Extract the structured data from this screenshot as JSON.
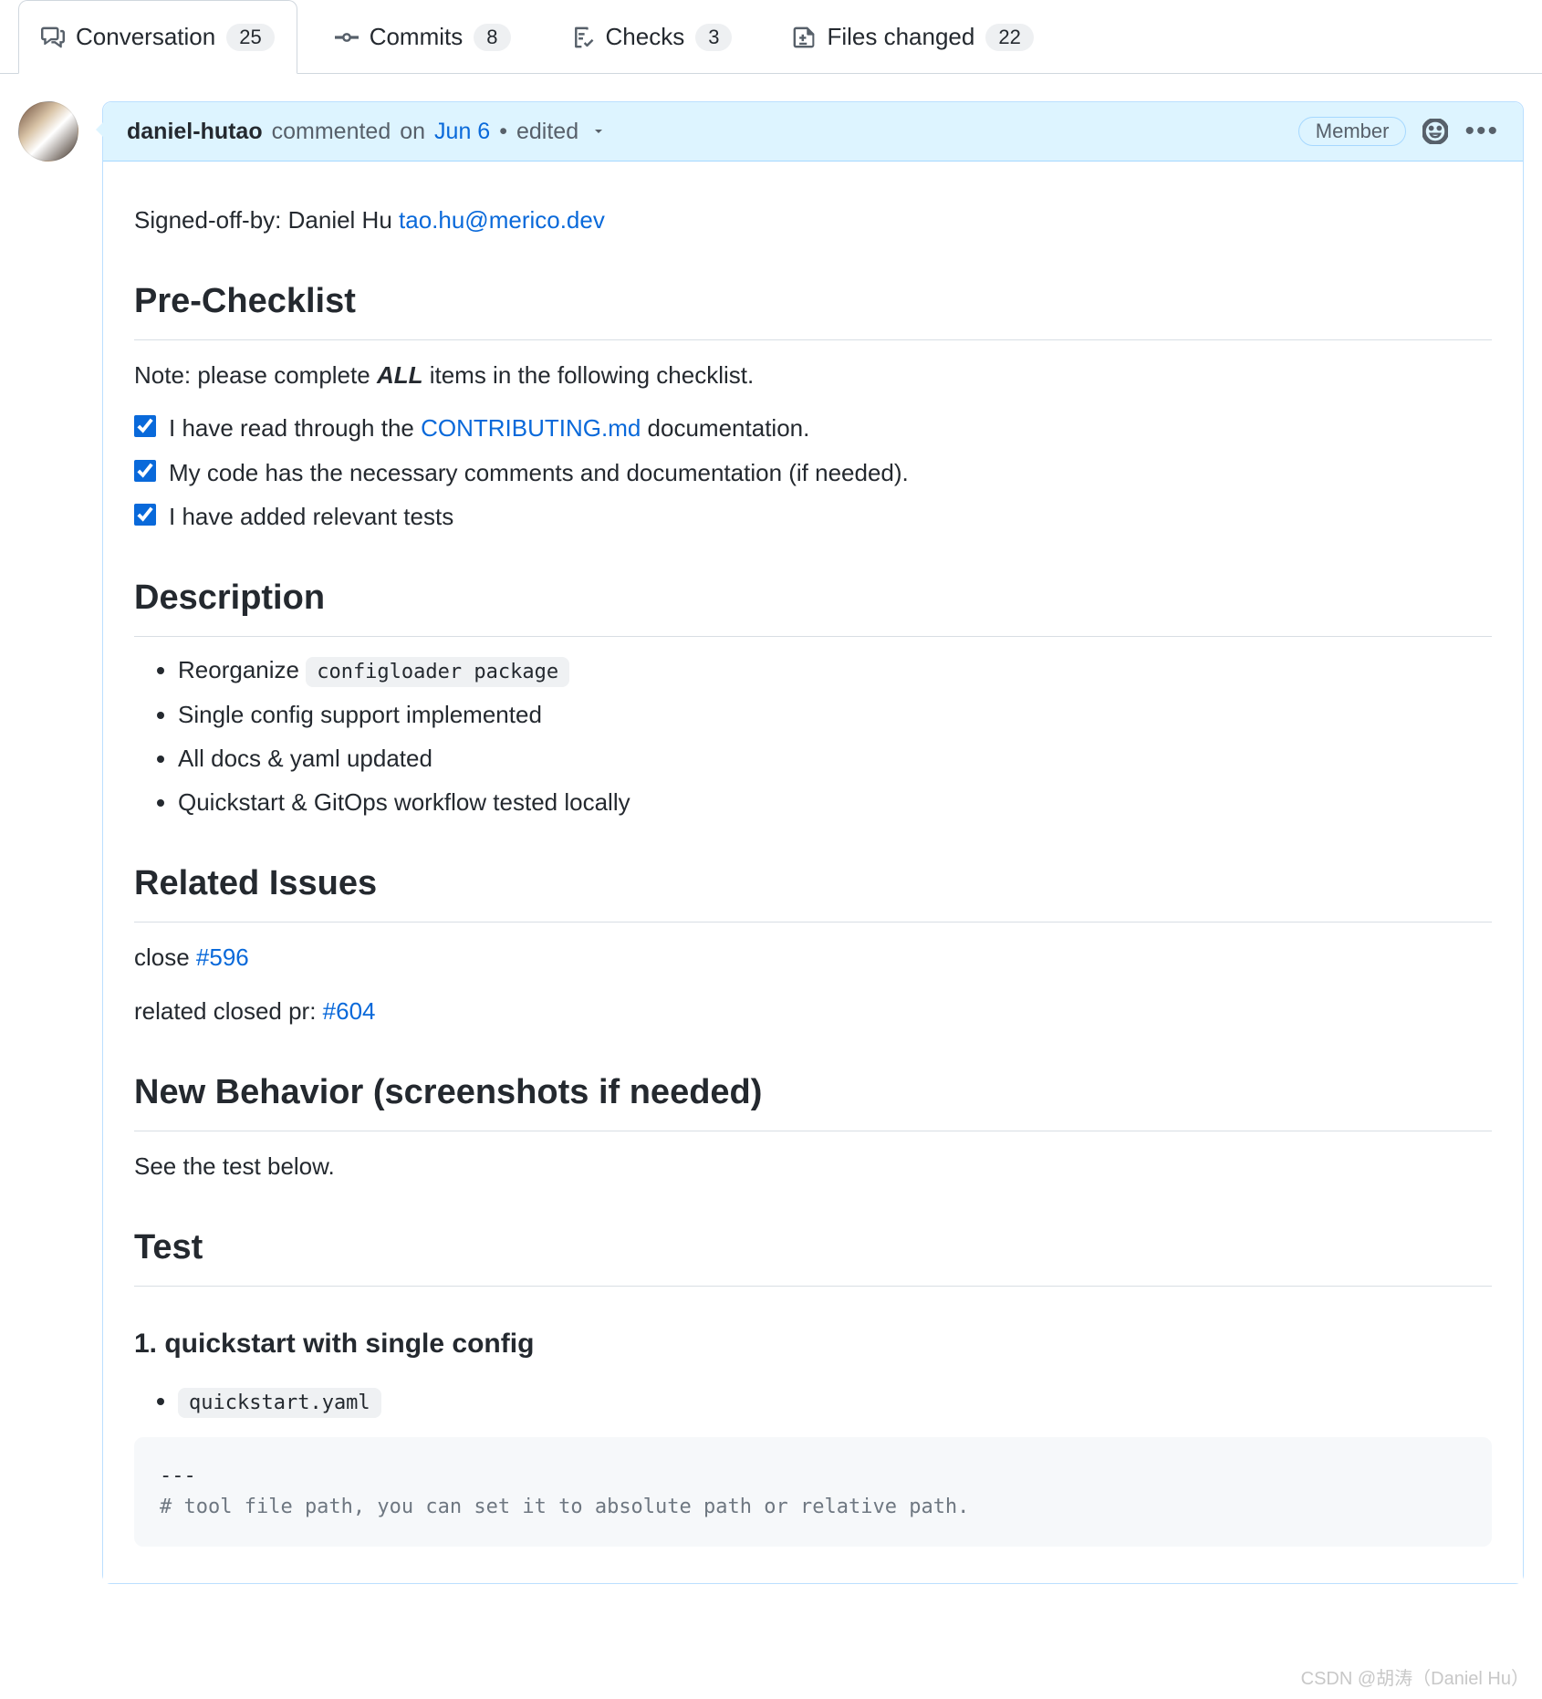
{
  "tabs": {
    "conversation": {
      "label": "Conversation",
      "count": "25"
    },
    "commits": {
      "label": "Commits",
      "count": "8"
    },
    "checks": {
      "label": "Checks",
      "count": "3"
    },
    "files": {
      "label": "Files changed",
      "count": "22"
    }
  },
  "comment": {
    "author": "daniel-hutao",
    "action": "commented",
    "time_prefix": "on",
    "time": "Jun 6",
    "edited_label": "edited",
    "badge": "Member",
    "signed_prefix": "Signed-off-by: Daniel Hu ",
    "signed_email": "tao.hu@merico.dev",
    "headings": {
      "pre_checklist": "Pre-Checklist",
      "description": "Description",
      "related_issues": "Related Issues",
      "new_behavior": "New Behavior (screenshots if needed)",
      "test": "Test"
    },
    "note_prefix": "Note: please complete ",
    "note_all": "ALL",
    "note_suffix": " items in the following checklist.",
    "checklist": [
      {
        "before_link": "I have read through the ",
        "link": "CONTRIBUTING.md",
        "after_link": " documentation."
      },
      {
        "text": "My code has the necessary comments and documentation (if needed)."
      },
      {
        "text": "I have added relevant tests"
      }
    ],
    "description_items": {
      "item0_prefix": "Reorganize ",
      "item0_code": "configloader package",
      "item1": "Single config support implemented",
      "item2": "All docs & yaml updated",
      "item3": "Quickstart & GitOps workflow tested locally"
    },
    "related": {
      "close_prefix": "close ",
      "close_link": "#596",
      "related_prefix": "related closed pr: ",
      "related_link": "#604"
    },
    "new_behavior_text": "See the test below.",
    "test_section": {
      "h3": "1. quickstart with single config",
      "bullet_code": "quickstart.yaml",
      "code_line1": "---",
      "code_line2": "# tool file path, you can set it to absolute path or relative path."
    }
  },
  "watermark": "CSDN @胡涛（Daniel Hu）"
}
